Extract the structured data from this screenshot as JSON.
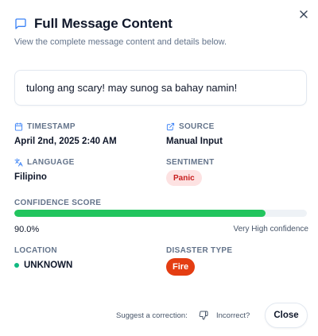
{
  "dialog": {
    "title": "Full Message Content",
    "subtitle": "View the complete message content and details below.",
    "close_icon": "close-icon"
  },
  "message": {
    "text": "tulong ang scary! may sunog sa bahay namin!"
  },
  "details": {
    "timestamp_label": "TIMESTAMP",
    "timestamp_value": "April 2nd, 2025 2:40 AM",
    "source_label": "SOURCE",
    "source_value": "Manual Input",
    "language_label": "LANGUAGE",
    "language_value": "Filipino",
    "sentiment_label": "SENTIMENT",
    "sentiment_value": "Panic",
    "confidence_label": "CONFIDENCE SCORE",
    "confidence_value": "90.0%",
    "confidence_fraction": 0.9,
    "confidence_level": "Very High confidence",
    "location_label": "LOCATION",
    "location_value": "UNKNOWN",
    "disaster_label": "DISASTER TYPE",
    "disaster_value": "Fire"
  },
  "footer": {
    "suggest_text": "Suggest a correction:",
    "incorrect_label": "Incorrect?",
    "close_label": "Close"
  },
  "colors": {
    "progress": "#22c55e",
    "panic_bg": "#fde2e2",
    "panic_text": "#c81e1e",
    "fire_bg": "#e43d12",
    "location_dot": "#10b981",
    "accent_icon": "#3b82f6"
  }
}
